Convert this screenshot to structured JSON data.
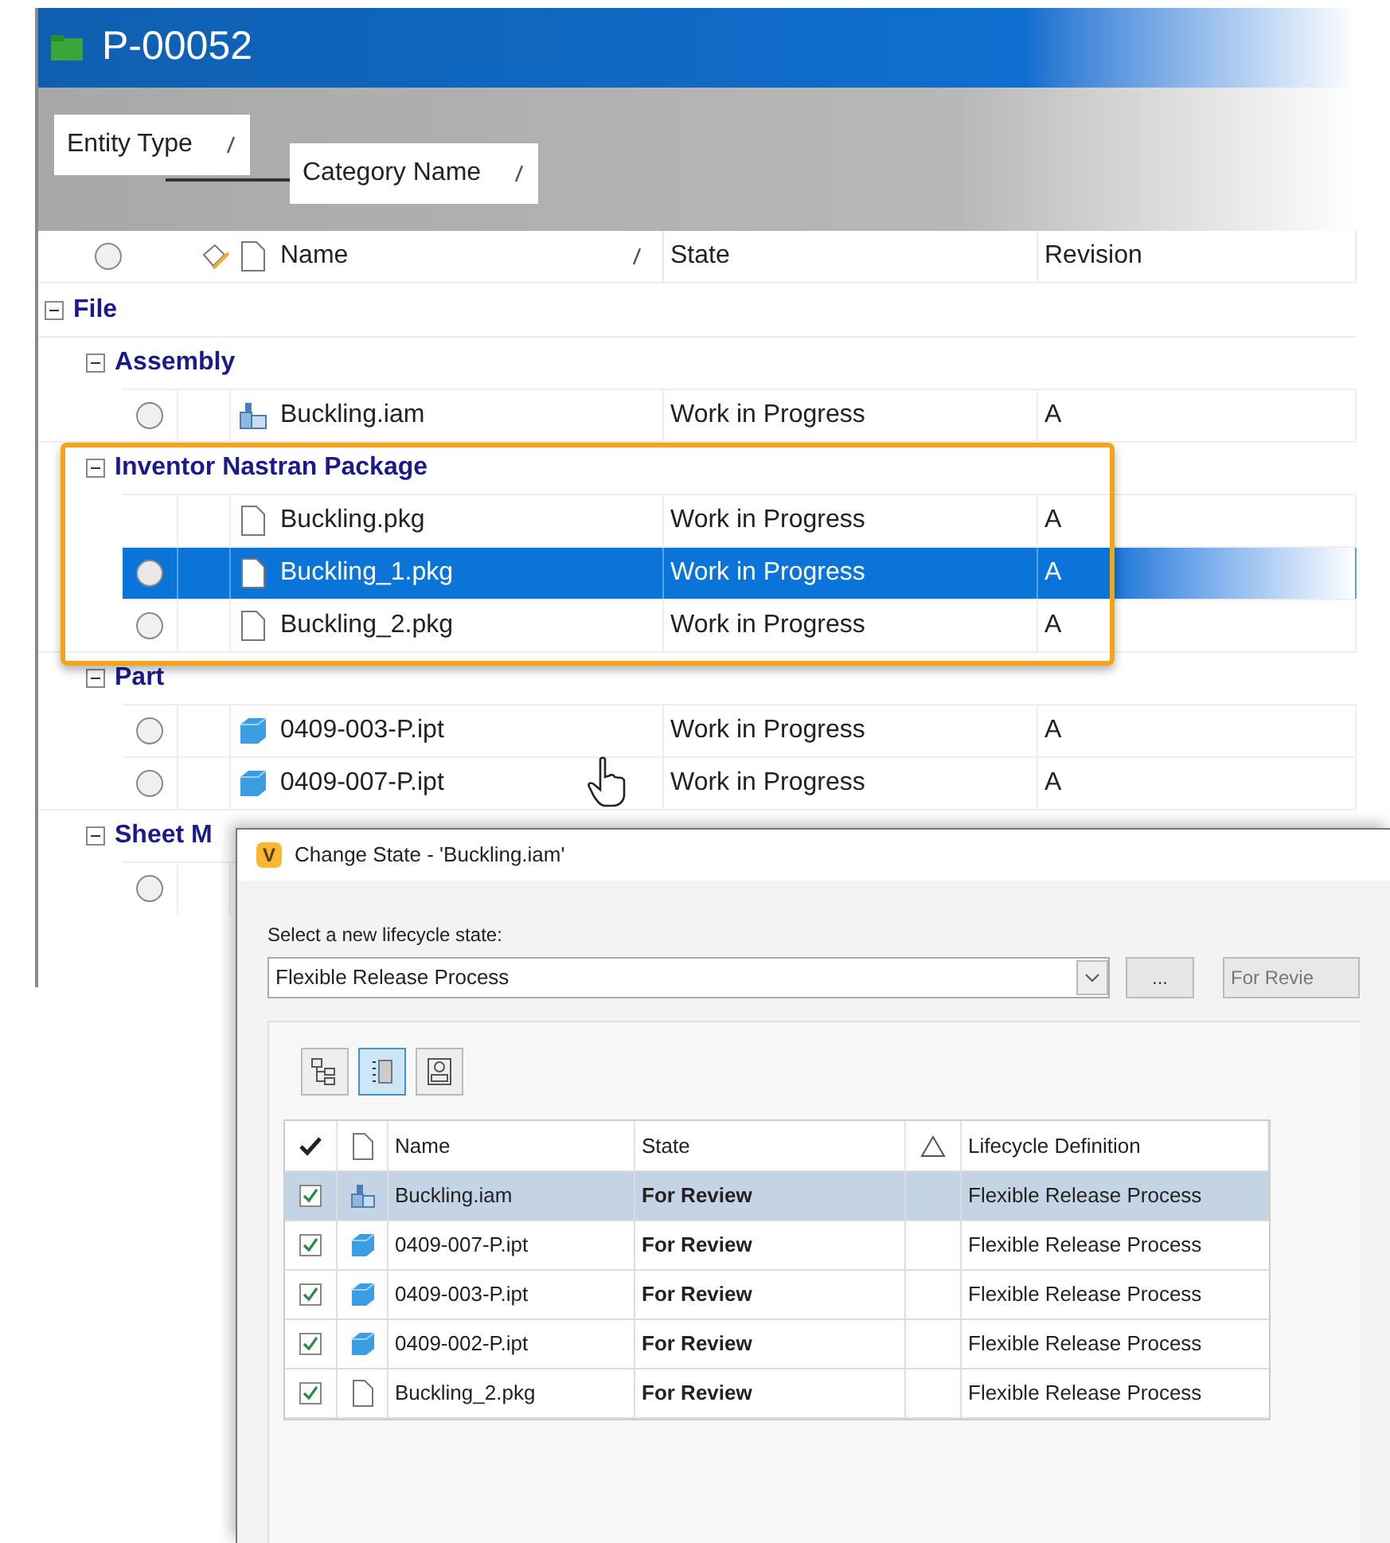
{
  "window": {
    "title": "P-00052"
  },
  "grouping": [
    {
      "label": "Entity Type"
    },
    {
      "label": "Category Name"
    }
  ],
  "select_all": false,
  "columns": [
    {
      "label": "Name",
      "sorted": true
    },
    {
      "label": "State",
      "sorted": false
    },
    {
      "label": "Revision",
      "sorted": false
    }
  ],
  "tree": [
    {
      "label": "File",
      "expanded": true,
      "children": [
        {
          "label": "Assembly",
          "expanded": true,
          "rows": [
            {
              "name": "Buckling.iam",
              "state": "Work in Progress",
              "revision": "A",
              "kind": "assembly",
              "radio": true,
              "selected": false
            }
          ]
        },
        {
          "label": "Inventor Nastran Package",
          "expanded": true,
          "rows": [
            {
              "name": "Buckling.pkg",
              "state": "Work in Progress",
              "revision": "A",
              "kind": "document",
              "radio": false,
              "selected": false
            },
            {
              "name": "Buckling_1.pkg",
              "state": "Work in Progress",
              "revision": "A",
              "kind": "document",
              "radio": true,
              "selected": true
            },
            {
              "name": "Buckling_2.pkg",
              "state": "Work in Progress",
              "revision": "A",
              "kind": "document",
              "radio": true,
              "selected": false
            }
          ]
        },
        {
          "label": "Part",
          "expanded": true,
          "rows": [
            {
              "name": "0409-003-P.ipt",
              "state": "Work in Progress",
              "revision": "A",
              "kind": "part",
              "radio": true,
              "selected": false
            },
            {
              "name": "0409-007-P.ipt",
              "state": "Work in Progress",
              "revision": "A",
              "kind": "part",
              "radio": true,
              "selected": false
            }
          ]
        },
        {
          "label": "Sheet M",
          "expanded": true,
          "rows": [
            {
              "kind": "none",
              "radio": true,
              "selected": false
            }
          ]
        }
      ]
    }
  ],
  "dialog": {
    "app_icon_letter": "V",
    "title": "Change State - 'Buckling.iam'",
    "prompt": "Select a new lifecycle state:",
    "lifecycle": "Flexible Release Process",
    "more_button": "...",
    "state_value": "For Revie",
    "view_buttons": [
      {
        "kind": "tree",
        "selected": false
      },
      {
        "kind": "list",
        "selected": true
      },
      {
        "kind": "detail",
        "selected": false
      }
    ],
    "columns": [
      {
        "label": "Name"
      },
      {
        "label": "State"
      },
      {
        "label": "Lifecycle Definition"
      }
    ],
    "rows": [
      {
        "checked": true,
        "kind": "assembly",
        "name": "Buckling.iam",
        "state": "For Review",
        "lifecycle": "Flexible Release Process",
        "selected": true
      },
      {
        "checked": true,
        "kind": "part",
        "name": "0409-007-P.ipt",
        "state": "For Review",
        "lifecycle": "Flexible Release Process",
        "selected": false
      },
      {
        "checked": true,
        "kind": "part",
        "name": "0409-003-P.ipt",
        "state": "For Review",
        "lifecycle": "Flexible Release Process",
        "selected": false
      },
      {
        "checked": true,
        "kind": "part",
        "name": "0409-002-P.ipt",
        "state": "For Review",
        "lifecycle": "Flexible Release Process",
        "selected": false
      },
      {
        "checked": true,
        "kind": "document",
        "name": "Buckling_2.pkg",
        "state": "For Review",
        "lifecycle": "Flexible Release Process",
        "selected": false
      }
    ]
  }
}
